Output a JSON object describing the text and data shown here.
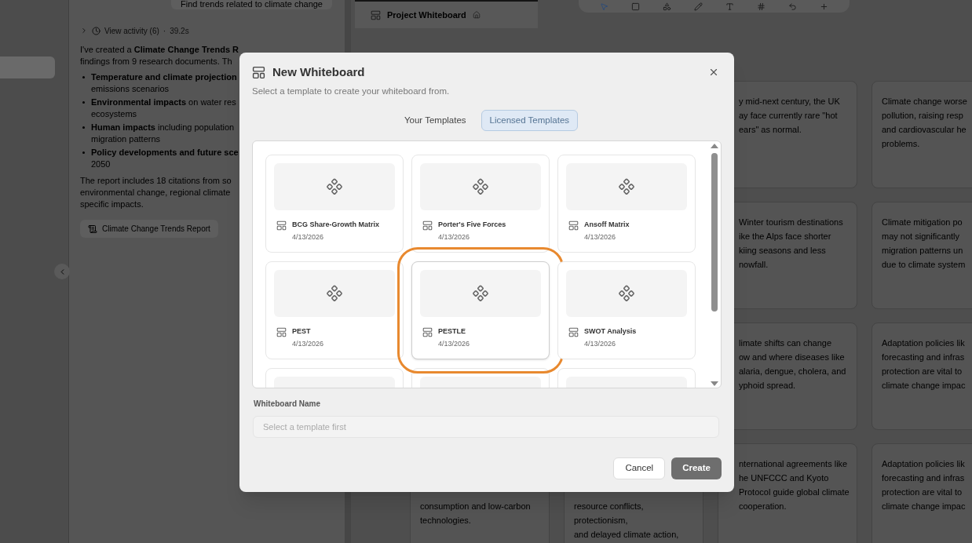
{
  "sidebar": {
    "items": [
      {
        "selected": true
      }
    ]
  },
  "chat": {
    "user_message": "Find trends related to climate change",
    "activity": {
      "label": "View activity (6)",
      "separator": "·",
      "duration": "39.2s"
    },
    "intro_lines": [
      "I've created a **Climate Change Trends R**",
      "findings from 9 research documents. Th"
    ],
    "bullets": [
      {
        "lines": [
          "**Temperature and climate projection**",
          "emissions scenarios"
        ]
      },
      {
        "lines": [
          "**Environmental impacts** on water res",
          "ecosystems"
        ]
      },
      {
        "lines": [
          "**Human impacts** including population",
          "migration patterns"
        ]
      },
      {
        "lines": [
          "**Policy developments and future sce**",
          "2050"
        ]
      }
    ],
    "closing_lines": [
      "The report includes 18 citations from so",
      "environmental change, regional climate",
      "specific impacts."
    ],
    "attachment": "Climate Change Trends Report"
  },
  "whiteboard_tab": {
    "label": "Project Whiteboard"
  },
  "canvas": {
    "rows": [
      [
        {},
        {},
        {
          "lines": [
            "y mid-next century, the UK",
            "ay face currently rare \"hot",
            "ears\" as normal."
          ]
        },
        {
          "lines": [
            "Climate change worse",
            "pollution, raising resp",
            "and cardiovascular he",
            "problems."
          ]
        }
      ],
      [
        {},
        {},
        {
          "lines": [
            "Winter tourism destinations",
            "ike the Alps face shorter",
            "kiing seasons and less",
            "nowfall."
          ]
        },
        {
          "lines": [
            "Climate mitigation po",
            "may not significantly",
            "migration patterns un",
            "due to climate system"
          ]
        }
      ],
      [
        {},
        {},
        {
          "lines": [
            "limate shifts can change",
            "ow and where diseases like",
            "alaria, dengue, cholera, and",
            "yphoid spread."
          ]
        },
        {
          "lines": [
            "Adaptation policies lik",
            "forecasting and infras",
            "protection are vital to",
            "climate change impac"
          ]
        }
      ],
      [
        {
          "lines": [
            "consumption and low-carbon",
            "technologies."
          ],
          "partly_covered": true
        },
        {
          "lines": [
            "resource conflicts,",
            "protectionism,",
            "and delayed climate action,"
          ],
          "partly_covered": true
        },
        {
          "lines": [
            "nternational agreements like",
            "he UNFCCC and Kyoto",
            "Protocol guide global climate",
            "cooperation."
          ]
        },
        {
          "lines": [
            "Adaptation policies lik",
            "forecasting and infras",
            "protection are vital to",
            "climate change impac"
          ]
        }
      ]
    ]
  },
  "dialog": {
    "title": "New Whiteboard",
    "subtitle": "Select a template to create your whiteboard from.",
    "tabs": [
      {
        "label": "Your Templates",
        "selected": false
      },
      {
        "label": "Licensed Templates",
        "selected": true
      }
    ],
    "templates": [
      {
        "name": "BCG Share-Growth Matrix",
        "date": "4/13/2026",
        "highlighted": false
      },
      {
        "name": "Porter's Five Forces",
        "date": "4/13/2026",
        "highlighted": false
      },
      {
        "name": "Ansoff Matrix",
        "date": "4/13/2026",
        "highlighted": false
      },
      {
        "name": "PEST",
        "date": "4/13/2026",
        "highlighted": false
      },
      {
        "name": "PESTLE",
        "date": "4/13/2026",
        "highlighted": true
      },
      {
        "name": "SWOT Analysis",
        "date": "4/13/2026",
        "highlighted": false
      }
    ],
    "name_field": {
      "label": "Whiteboard Name",
      "placeholder": "Select a template first"
    },
    "buttons": [
      {
        "label": "Cancel",
        "kind": "secondary"
      },
      {
        "label": "Create",
        "kind": "primary"
      }
    ]
  }
}
